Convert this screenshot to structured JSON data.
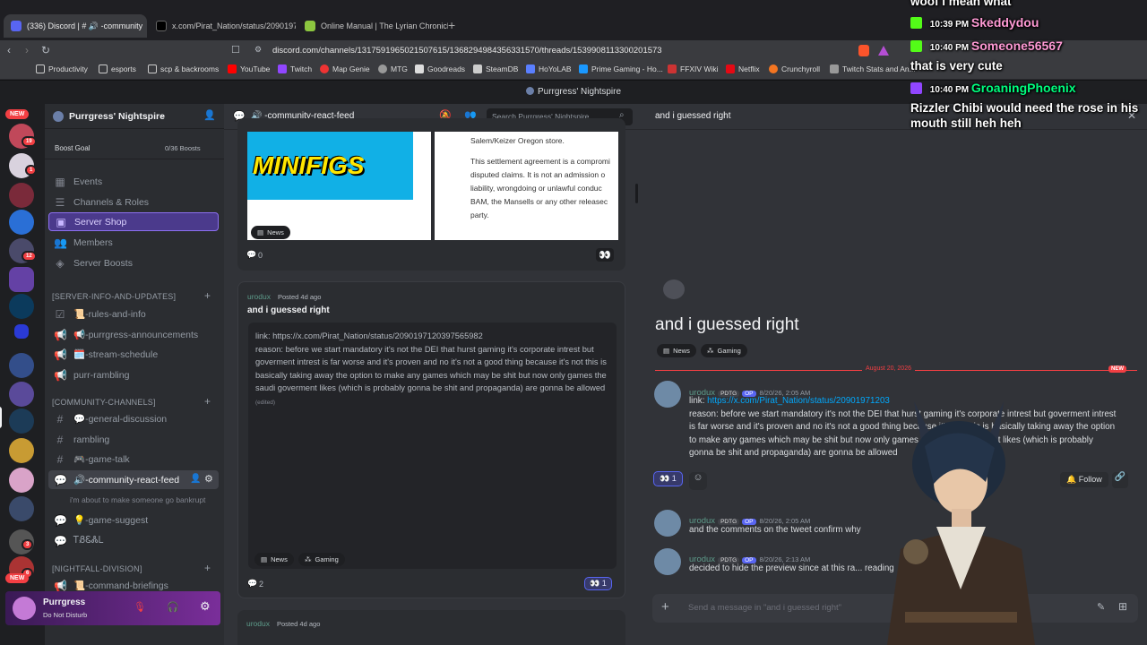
{
  "browser": {
    "tabs": [
      {
        "label": "(336) Discord | # 🔊 -community",
        "active": true,
        "color": "#5865f2"
      },
      {
        "label": "x.com/Pirat_Nation/status/209019712...",
        "active": false,
        "color": "#000000"
      },
      {
        "label": "Online Manual | The Lyrian Chronicle",
        "active": false,
        "color": "#8cc63f"
      }
    ],
    "url": "discord.com/channels/1317591965021507615/1368294984356331570/threads/1539908113300201573",
    "bookmarks": [
      "Productivity",
      "esports",
      "scp & backrooms",
      "YouTube",
      "Twitch",
      "Map Genie",
      "MTG",
      "Goodreads",
      "SteamDB",
      "HoYoLAB",
      "Prime Gaming - Ho...",
      "FFXIV Wiki",
      "Netflix",
      "Crunchyroll",
      "Twitch Stats and An..."
    ]
  },
  "window_title": "Purrgress' Nightspire",
  "rail": {
    "badges": [
      "19",
      "1",
      "12",
      "3",
      "6"
    ],
    "new_label": "NEW"
  },
  "server": {
    "name": "Purrgress' Nightspire",
    "boost_goal": "Boost Goal",
    "boost_count": "0/36 Boosts",
    "top_items": [
      "Events",
      "Channels & Roles",
      "Server Shop",
      "Members",
      "Server Boosts"
    ],
    "categories": [
      {
        "name": "[SERVER-INFO-AND-UPDATES]",
        "channels": [
          "📜-rules-and-info",
          "📢-purrgress-announcements",
          "🗓️-stream-schedule",
          "purr-rambling"
        ]
      },
      {
        "name": "[COMMUNITY-CHANNELS]",
        "channels": [
          "💬-general-discussion",
          "rambling",
          "🎮-game-talk",
          "🔊-community-react-feed",
          "💡-game-suggest",
          "ᎢᏰᏋᏜᏞ"
        ]
      },
      {
        "name": "[NIGHTFALL-DIVISION]",
        "channels": [
          "📜-command-briefings"
        ]
      }
    ],
    "thread_preview": "i'm about to make someone go bankrupt",
    "user_name": "Purrgress",
    "user_status": "Do Not Disturb"
  },
  "forum": {
    "title": "🔊 -community-react-feed",
    "search_placeholder": "Search Purrgress' Nightspire",
    "card1": {
      "image_text": "MINIFIGS",
      "doc_lines": [
        "Salem/Keizer Oregon store.",
        "This settlement agreement is a compromi",
        "disputed claims. It is not an admission o",
        "liability, wrongdoing or unlawful conduc",
        "BAM, the Mansells or any other releasec",
        "party."
      ],
      "tag": "News",
      "comments": "0",
      "reaction": "👀"
    },
    "card2": {
      "author": "urodux",
      "posted": "Posted 4d ago",
      "title": "and i guessed right",
      "body": "link: https://x.com/Pirat_Nation/status/2090197120397565982\nreason: before we start mandatory it's not the DEI that hurst gaming it's corporate intrest but goverment intrest is far worse and it's proven and no it's not a good thing because it's not this is basically taking away the option to make any games which may be shit but now only games the saudi goverment likes (which is probably gonna be shit and propaganda) are gonna be allowed",
      "edited": "(edited)",
      "tags": [
        "News",
        "Gaming"
      ],
      "comments": "2",
      "reaction_emoji": "👀",
      "reaction_count": "1"
    },
    "card3": {
      "author": "urodux",
      "posted": "Posted 4d ago"
    }
  },
  "thread": {
    "header_title": "and i guessed right",
    "title": "and i guessed right",
    "tags": [
      "News",
      "Gaming"
    ],
    "date_divider": "August 20, 2026",
    "new_label": "NEW",
    "messages": [
      {
        "author": "urodux",
        "guild_tag": "PDTG",
        "op": "OP",
        "time": "8/20/26, 2:05 AM",
        "link": "https://x.com/Pirat_Nation/status/20901971203",
        "text": "reason: before we start mandatory it's not the DEI that hurst gaming it's corporate intrest but goverment intrest is far worse and it's proven and no it's not a good thing because it's not this is basically taking away the option to make any games which may be shit but now only games the saudi goverment likes (which is probably gonna be shit and propaganda) are gonna be allowed"
      },
      {
        "author": "urodux",
        "guild_tag": "PDTG",
        "op": "OP",
        "time": "8/20/26, 2:05 AM",
        "text": "and the comments on the tweet confirm why"
      },
      {
        "author": "urodux",
        "guild_tag": "PDTG",
        "op": "OP",
        "time": "8/20/26, 2:13 AM",
        "text": "decided to hide the preview since at this ra... reading"
      }
    ],
    "reaction_emoji": "👀",
    "reaction_count": "1",
    "follow": "Follow",
    "link_label": "link:",
    "input_placeholder": "Send a message in \"and i guessed right\""
  },
  "stream_overlay": [
    {
      "text": "woof i mean what"
    },
    {
      "time": "10:39 PM",
      "user": "Skeddydou",
      "color": "#ff9ad5"
    },
    {
      "time": "10:40 PM",
      "user": "Someone56567",
      "color": "#ff9ad5"
    },
    {
      "text": "that is very cute"
    },
    {
      "time": "10:40 PM",
      "user": "GroaningPhoenix",
      "color": "#00ff7f"
    },
    {
      "text": "Rizzler Chibi would need the rose in his mouth still heh heh"
    }
  ],
  "colors": {
    "accent": "#5865f2",
    "server_shop": "#4b3a8c",
    "new_red": "#f23f43",
    "link": "#00a8fc",
    "tag_kick": "#53fc18",
    "tag_twitch": "#9146ff"
  }
}
